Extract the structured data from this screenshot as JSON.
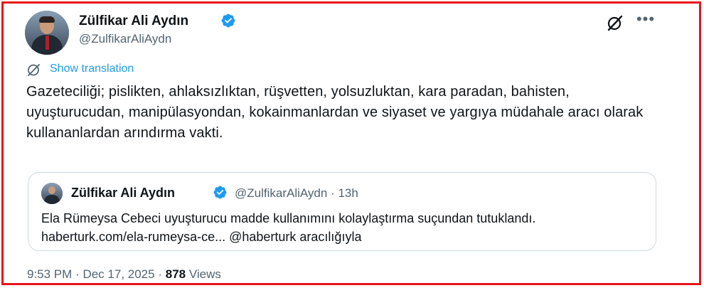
{
  "author": {
    "name": "Zülfikar Ali Aydın",
    "handle": "@ZulfikarAliAydn"
  },
  "translate": {
    "label": "Show translation"
  },
  "tweet": {
    "text": "Gazeteciliği; pislikten, ahlaksızlıktan, rüşvetten, yolsuzluktan, kara paradan, bahisten, uyuşturucudan, manipülasyondan, kokainmanlardan ve siyaset ve yargıya müdahale aracı olarak kullananlardan arındırma vakti."
  },
  "quote": {
    "name": "Zülfikar Ali Aydın",
    "handle": "@ZulfikarAliAydn",
    "separator": "·",
    "age": "13h",
    "text": "Ela Rümeysa Cebeci uyuşturucu madde kullanımını kolaylaştırma suçundan tutuklandı. haberturk.com/ela-rumeysa-ce... @haberturk aracılığıyla"
  },
  "footer": {
    "time": "9:53 PM",
    "separator": "·",
    "date": "Dec 17, 2025",
    "views_count": "878",
    "views_label": "Views"
  },
  "icons": {
    "verified": "verified-badge-icon",
    "grok": "grok-icon",
    "more": "more-icon",
    "translate": "translate-icon"
  },
  "colors": {
    "frame_border": "#e8141b",
    "accent": "#1d9bf0",
    "text_primary": "#0f1419",
    "text_secondary": "#536471",
    "quote_border": "#cfd9de"
  }
}
